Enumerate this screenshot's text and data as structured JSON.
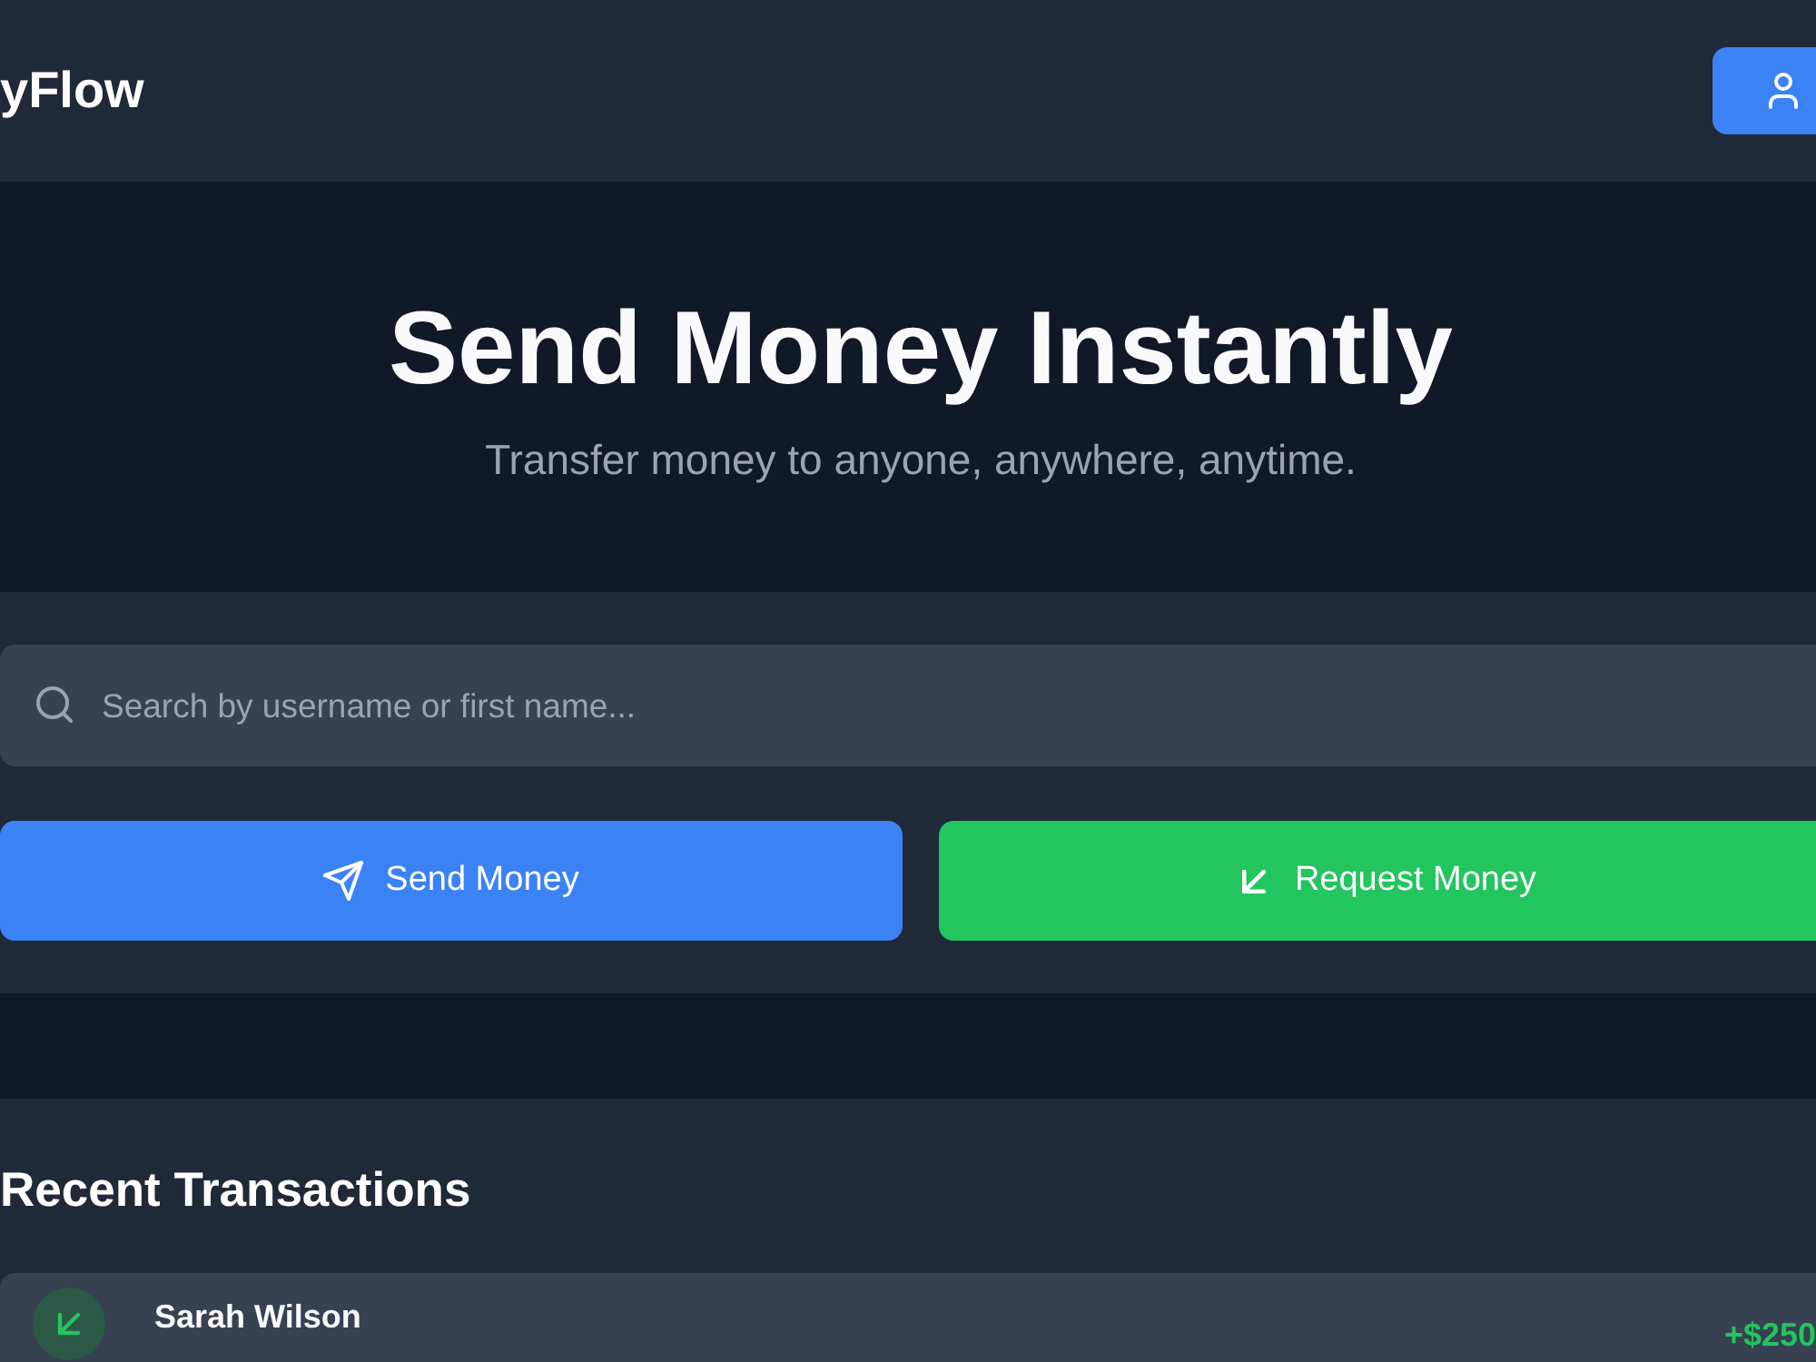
{
  "header": {
    "logo": "yFlow"
  },
  "hero": {
    "title": "Send Money Instantly",
    "subtitle": "Transfer money to anyone, anywhere, anytime."
  },
  "search": {
    "placeholder": "Search by username or first name..."
  },
  "actions": [
    {
      "kind": "send",
      "label": "Send Money"
    },
    {
      "kind": "request",
      "label": "Request Money"
    }
  ],
  "transactions": {
    "title": "Recent Transactions",
    "items": [
      {
        "kind": "received",
        "name": "Sarah Wilson",
        "amount": "+$250"
      }
    ]
  }
}
